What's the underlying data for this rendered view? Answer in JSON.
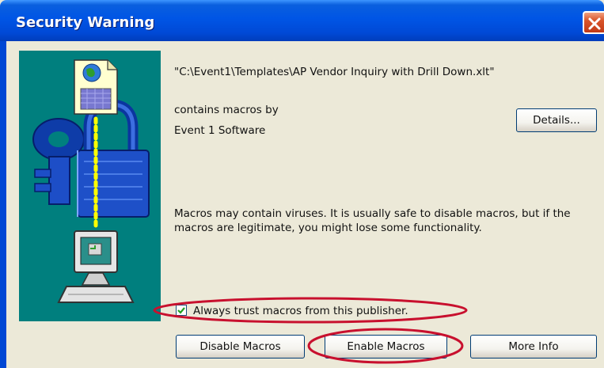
{
  "dialog": {
    "title": "Security Warning",
    "file_path": "\"C:\\Event1\\Templates\\AP Vendor Inquiry with Drill Down.xlt\"",
    "contains_macros_label": "contains macros by",
    "publisher": "Event 1 Software",
    "warning_line1": "Macros may contain viruses. It is usually safe to disable macros, but if the",
    "warning_line2": "macros are legitimate, you might lose some functionality.",
    "checkbox_label": "Always trust macros from this publisher.",
    "checkbox_checked": true
  },
  "buttons": {
    "details": "Details...",
    "disable": "Disable Macros",
    "enable": "Enable Macros",
    "more_info": "More Info"
  },
  "icons": {
    "close": "close-icon",
    "document": "document-globe-icon",
    "lock": "padlock-icon",
    "key": "key-icon",
    "computer": "computer-icon",
    "checkmark": "checkmark-icon"
  },
  "colors": {
    "titlebar": "#0055E5",
    "panel_bg": "#ECE9D8",
    "art_bg": "#007F7E",
    "close_button": "#D9542A",
    "annotation": "#C8102E"
  }
}
